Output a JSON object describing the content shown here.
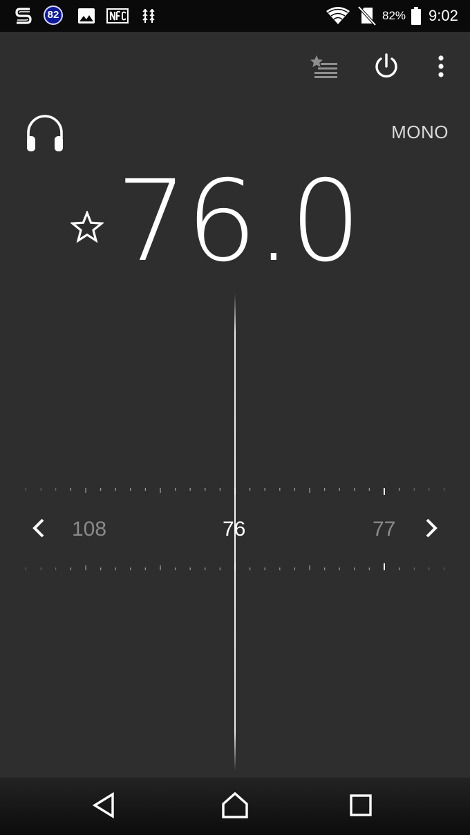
{
  "status_bar": {
    "notification_icons": [
      "sony-s-icon",
      "badge-icon",
      "image-icon",
      "nfc-icon",
      "usb-debug-icon"
    ],
    "badge_count": "82",
    "system_icons": [
      "wifi-icon",
      "no-sim-icon",
      "battery-icon"
    ],
    "battery_percent": "82%",
    "time": "9:02"
  },
  "toolbar": {
    "icons": [
      "favorites-list-icon",
      "power-icon",
      "overflow-menu-icon"
    ]
  },
  "audio": {
    "output_icon": "headphones-icon",
    "mode": "MONO"
  },
  "tuner": {
    "frequency": "76.0",
    "favorite_icon": "star-outline-icon",
    "prev_label": "108",
    "current_label": "76",
    "next_label": "77",
    "prev_arrow": "chevron-left-icon",
    "next_arrow": "chevron-right-icon"
  },
  "nav_bar": {
    "icons": [
      "back-icon",
      "home-icon",
      "recents-icon"
    ]
  },
  "colors": {
    "background": "#2e2e2e",
    "status_bar": "#0a0a0a",
    "text_primary": "#ffffff",
    "text_dim": "#8a8a8a",
    "badge_blue": "#0d1a9b"
  }
}
